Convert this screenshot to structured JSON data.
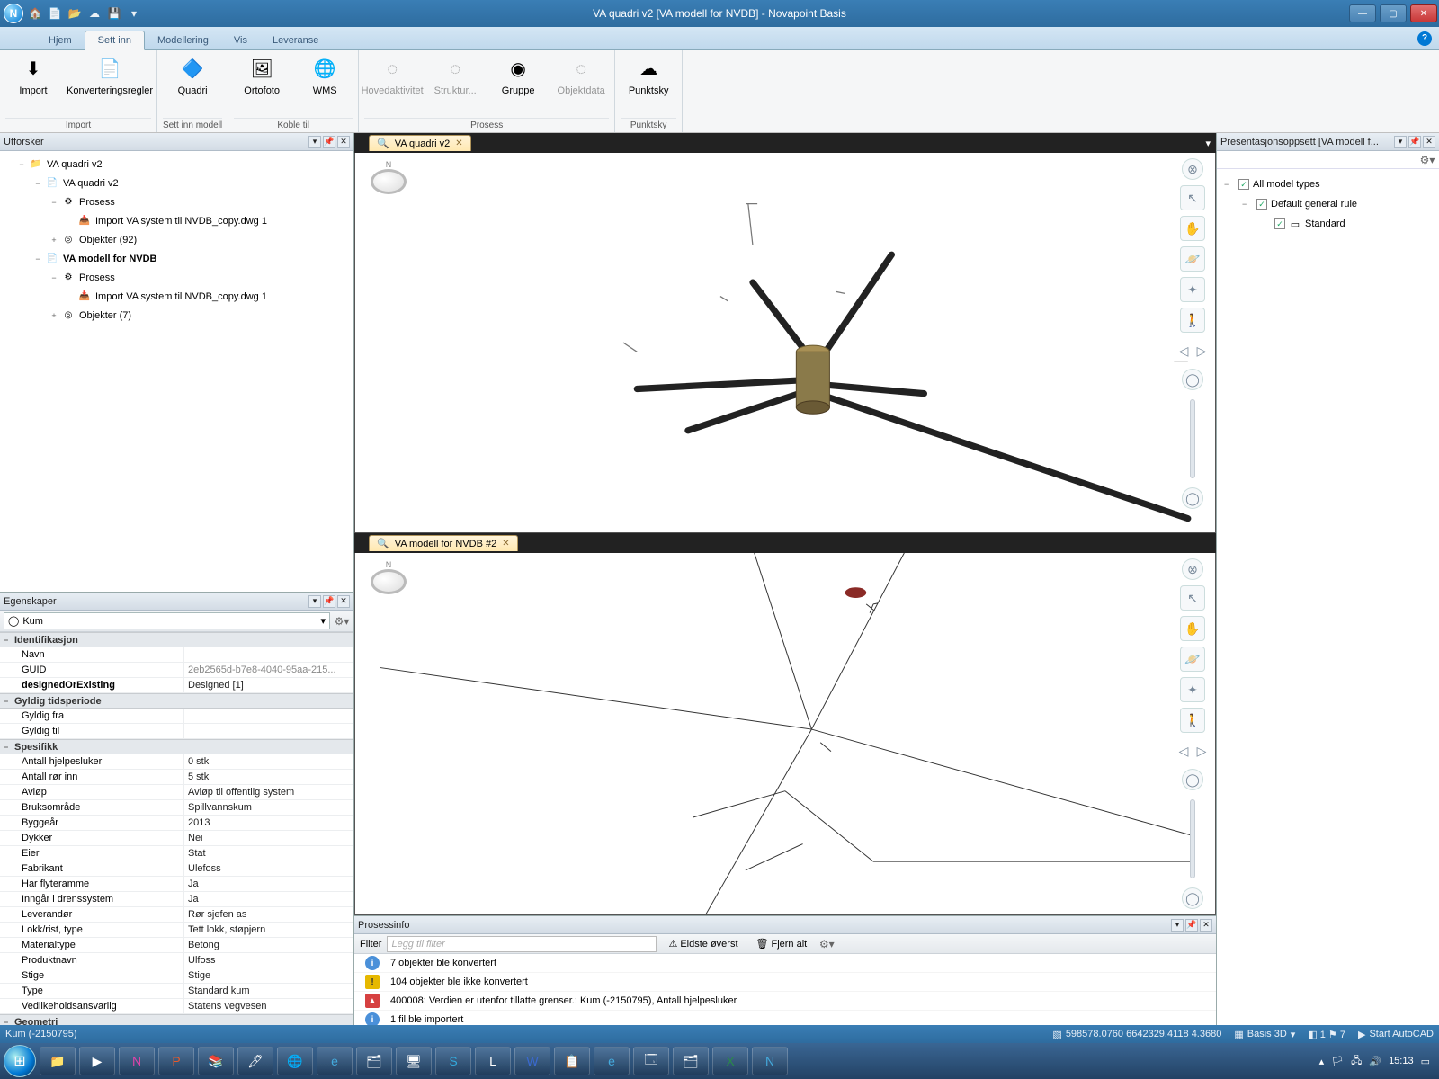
{
  "window": {
    "title": "VA quadri v2 [VA modell for NVDB] - Novapoint Basis",
    "orb": "N"
  },
  "tabs": [
    "Hjem",
    "Sett inn",
    "Modellering",
    "Vis",
    "Leveranse"
  ],
  "active_tab": "Sett inn",
  "ribbon": {
    "groups": [
      {
        "label": "Import",
        "buttons": [
          {
            "label": "Import",
            "icon": "⬇",
            "name": "import-button"
          },
          {
            "label": "Konverteringsregler",
            "icon": "📄",
            "name": "conversion-rules-button",
            "wide": true
          }
        ]
      },
      {
        "label": "Sett inn modell",
        "buttons": [
          {
            "label": "Quadri",
            "icon": "🔷",
            "name": "quadri-button"
          }
        ]
      },
      {
        "label": "Koble til",
        "buttons": [
          {
            "label": "Ortofoto",
            "icon": "🖼",
            "name": "orthophoto-button"
          },
          {
            "label": "WMS",
            "icon": "🌐",
            "name": "wms-button"
          }
        ]
      },
      {
        "label": "Prosess",
        "buttons": [
          {
            "label": "Hovedaktivitet",
            "icon": "◌",
            "name": "main-activity-button",
            "disabled": true
          },
          {
            "label": "Struktur...",
            "icon": "◌",
            "name": "structure-button",
            "disabled": true
          },
          {
            "label": "Gruppe",
            "icon": "◉",
            "name": "group-button"
          },
          {
            "label": "Objektdata",
            "icon": "◌",
            "name": "objectdata-button",
            "disabled": true
          }
        ]
      },
      {
        "label": "Punktsky",
        "buttons": [
          {
            "label": "Punktsky",
            "icon": "☁",
            "name": "pointcloud-button"
          }
        ]
      }
    ]
  },
  "explorer": {
    "title": "Utforsker",
    "nodes": [
      {
        "level": 1,
        "tw": "−",
        "icon": "📁",
        "label": "VA quadri v2"
      },
      {
        "level": 2,
        "tw": "−",
        "icon": "📄",
        "label": "VA quadri v2"
      },
      {
        "level": 3,
        "tw": "−",
        "icon": "⚙",
        "label": "Prosess"
      },
      {
        "level": 4,
        "tw": "",
        "icon": "📥",
        "label": "Import VA system til NVDB_copy.dwg 1"
      },
      {
        "level": 3,
        "tw": "+",
        "icon": "◎",
        "label": "Objekter (92)"
      },
      {
        "level": 2,
        "tw": "−",
        "icon": "📄",
        "label": "VA modell for NVDB",
        "selected": true
      },
      {
        "level": 3,
        "tw": "−",
        "icon": "⚙",
        "label": "Prosess"
      },
      {
        "level": 4,
        "tw": "",
        "icon": "📥",
        "label": "Import VA system til NVDB_copy.dwg 1"
      },
      {
        "level": 3,
        "tw": "+",
        "icon": "◎",
        "label": "Objekter (7)"
      }
    ]
  },
  "properties": {
    "title": "Egenskaper",
    "selector": "Kum",
    "sections": [
      {
        "name": "Identifikasjon",
        "rows": [
          {
            "k": "Navn",
            "v": ""
          },
          {
            "k": "GUID",
            "v": "2eb2565d-b7e8-4040-95aa-215...",
            "grey": true
          },
          {
            "k": "designedOrExisting",
            "v": "Designed [1]",
            "bold": true
          }
        ]
      },
      {
        "name": "Gyldig tidsperiode",
        "rows": [
          {
            "k": "Gyldig fra",
            "v": ""
          },
          {
            "k": "Gyldig til",
            "v": ""
          }
        ]
      },
      {
        "name": "Spesifikk",
        "rows": [
          {
            "k": "Antall hjelpesluker",
            "v": "0 stk"
          },
          {
            "k": "Antall rør inn",
            "v": "5 stk"
          },
          {
            "k": "Avløp",
            "v": "Avløp til offentlig system"
          },
          {
            "k": "Bruksområde",
            "v": "Spillvannskum"
          },
          {
            "k": "Byggeår",
            "v": "2013"
          },
          {
            "k": "Dykker",
            "v": "Nei"
          },
          {
            "k": "Eier",
            "v": "Stat"
          },
          {
            "k": "Fabrikant",
            "v": "Ulefoss"
          },
          {
            "k": "Har flyteramme",
            "v": "Ja"
          },
          {
            "k": "Inngår i drenssystem",
            "v": "Ja"
          },
          {
            "k": "Leverandør",
            "v": "Rør sjefen as"
          },
          {
            "k": "Lokk/rist, type",
            "v": "Tett lokk, støpjern"
          },
          {
            "k": "Materialtype",
            "v": "Betong"
          },
          {
            "k": "Produktnavn",
            "v": "Ulfoss"
          },
          {
            "k": "Stige",
            "v": "Stige"
          },
          {
            "k": "Type",
            "v": "Standard kum"
          },
          {
            "k": "Vedlikeholdsansvarlig",
            "v": "Statens vegvesen"
          }
        ]
      },
      {
        "name": "Geometri",
        "rows": []
      }
    ]
  },
  "view_tabs": [
    {
      "label": "VA quadri v2",
      "icon": "🔍"
    },
    {
      "label": "VA modell for NVDB #2",
      "icon": "🔍"
    }
  ],
  "presentation": {
    "title": "Presentasjonsoppsett [VA modell f...",
    "rows": [
      {
        "level": 0,
        "tw": "−",
        "chk": true,
        "label": "All model types"
      },
      {
        "level": 1,
        "tw": "−",
        "chk": true,
        "label": "Default general rule"
      },
      {
        "level": 2,
        "tw": "",
        "chk": true,
        "label": "Standard",
        "icon": "▭"
      }
    ]
  },
  "process_info": {
    "title": "Prosessinfo",
    "filter_label": "Filter",
    "filter_placeholder": "Legg til filter",
    "oldest_top": "Eldste øverst",
    "clear_all": "Fjern alt",
    "rows": [
      {
        "type": "info",
        "text": "7 objekter ble konvertert"
      },
      {
        "type": "warn",
        "text": "104 objekter ble ikke konvertert"
      },
      {
        "type": "err",
        "text": "400008: Verdien er utenfor tillatte grenser.: Kum (-2150795), Antall hjelpesluker"
      },
      {
        "type": "info",
        "text": "1 fil ble importert"
      }
    ]
  },
  "status": {
    "left": "Kum (-2150795)",
    "coords": "598578.0760   6642329.4118   4.3680",
    "basis": "Basis 3D",
    "autocad": "Start AutoCAD"
  },
  "clock": "15:13"
}
